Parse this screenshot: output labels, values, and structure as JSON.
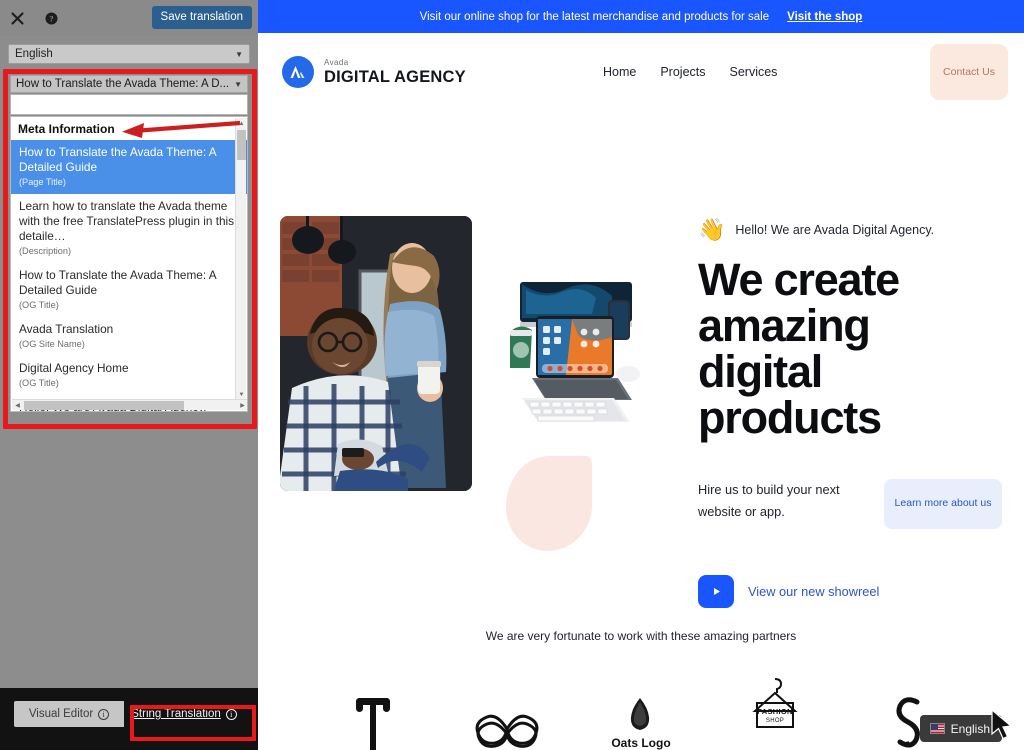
{
  "editor": {
    "close_icon": "close-icon",
    "help_icon": "help-icon",
    "save_label": "Save translation",
    "language_value": "English",
    "string_select_value": "How to Translate the Avada Theme: A D...",
    "search_value": "",
    "search_placeholder": "",
    "group_label": "Meta Information",
    "results": [
      {
        "text": "How to Translate the Avada Theme: A Detailed Guide",
        "sub": "(Page Title)",
        "selected": true
      },
      {
        "text": "Learn how to translate the Avada theme with the free TranslatePress plugin in this detaile…",
        "sub": "(Description)",
        "selected": false
      },
      {
        "text": "How to Translate the Avada Theme: A Detailed Guide",
        "sub": "(OG Title)",
        "selected": false
      },
      {
        "text": "Avada Translation",
        "sub": "(OG Site Name)",
        "selected": false
      },
      {
        "text": "Digital Agency Home",
        "sub": "(OG Title)",
        "selected": false
      },
      {
        "text": "Hello! We are Avada Digital Agency.",
        "sub": "",
        "selected": false
      }
    ],
    "bottom": {
      "visual_editor_label": "Visual Editor",
      "string_translation_label": "String Translation",
      "info_glyph": "i"
    },
    "accent_red": "#e8181b",
    "save_blue": "#2b5f8f",
    "selected_blue": "#4a90e8"
  },
  "site": {
    "notice": {
      "text": "Visit our online shop for the latest merchandise and products for sale",
      "link": "Visit the shop",
      "bg": "#1a56ff"
    },
    "header": {
      "brand_small": "Avada",
      "brand_big": "DIGITAL AGENCY",
      "logo_icon": "avada-logo-icon",
      "nav": [
        {
          "label": "Home"
        },
        {
          "label": "Projects"
        },
        {
          "label": "Services"
        }
      ],
      "contact_label": "Contact Us",
      "contact_bg": "#fbe9e0"
    },
    "hero": {
      "eyebrow_icon": "waving-hand-icon",
      "eyebrow": "Hello! We are Avada Digital Agency.",
      "title": "We create amazing digital products",
      "subtitle": "Hire us to build your next website or app.",
      "learn_more_label": "Learn more about us",
      "play_icon": "play-icon",
      "showreel_label": "View our new showreel",
      "photo_alt": "two-colleagues-photo",
      "device_alt": "tablet-and-phone-photo"
    },
    "partners": {
      "title": "We are very fortunate to work with these amazing partners",
      "logos": [
        {
          "name": "t-logo",
          "caption": ""
        },
        {
          "name": "infinity-logo",
          "caption": ""
        },
        {
          "name": "oats-logo",
          "caption": "Oats Logo"
        },
        {
          "name": "fashion-shop-logo",
          "caption": "FASHION",
          "caption2": "SHOP"
        },
        {
          "name": "s-logo",
          "caption": ""
        }
      ]
    },
    "language_switcher": {
      "label": "English",
      "flag": "us-flag-icon",
      "bg": "#3a3a3a"
    }
  }
}
